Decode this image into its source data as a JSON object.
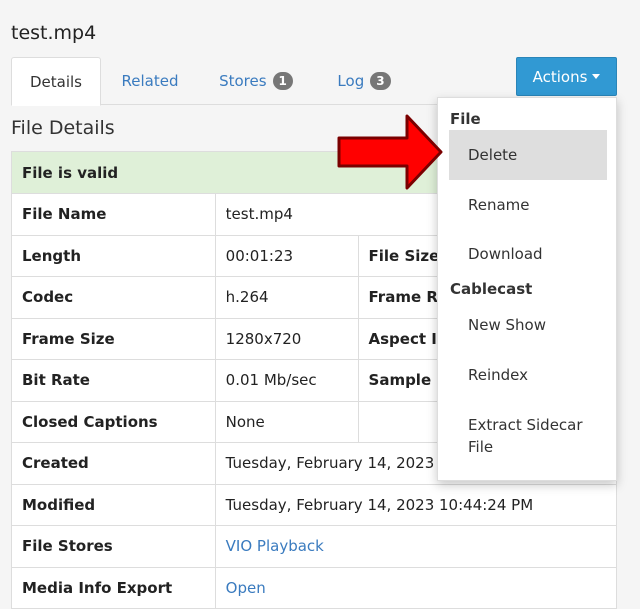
{
  "page": {
    "title": "test.mp4"
  },
  "tabs": [
    {
      "label": "Details",
      "badge": null
    },
    {
      "label": "Related",
      "badge": null
    },
    {
      "label": "Stores",
      "badge": "1"
    },
    {
      "label": "Log",
      "badge": "3"
    }
  ],
  "actions": {
    "label": "Actions"
  },
  "section_title": "File Details",
  "valid_message": "File is valid",
  "details": {
    "file_name_label": "File Name",
    "file_name": "test.mp4",
    "length_label": "Length",
    "length": "00:01:23",
    "file_size_label": "File Size",
    "codec_label": "Codec",
    "codec": "h.264",
    "frame_rate_label": "Frame R",
    "frame_size_label": "Frame Size",
    "frame_size": "1280x720",
    "aspect_label": "Aspect I",
    "bit_rate_label": "Bit Rate",
    "bit_rate": "0.01 Mb/sec",
    "sample_label": "Sample",
    "captions_label": "Closed Captions",
    "captions": "None",
    "created_label": "Created",
    "created": "Tuesday, February 14, 2023",
    "modified_label": "Modified",
    "modified": "Tuesday, February 14, 2023 10:44:24 PM",
    "stores_label": "File Stores",
    "stores_link": "VIO Playback",
    "export_label": "Media Info Export",
    "export_link": "Open"
  },
  "dropdown": {
    "file_header": "File",
    "file_items": [
      "Delete",
      "Rename",
      "Download"
    ],
    "cablecast_header": "Cablecast",
    "cablecast_items": [
      "New Show",
      "Reindex",
      "Extract Sidecar File"
    ]
  },
  "colors": {
    "accent": "#3199d3",
    "link": "#3a7bbf",
    "valid_bg": "#dff0d8",
    "arrow": "#ff0000"
  },
  "icons": {
    "caret": "caret-down-icon",
    "pointer": "red-arrow-icon"
  }
}
